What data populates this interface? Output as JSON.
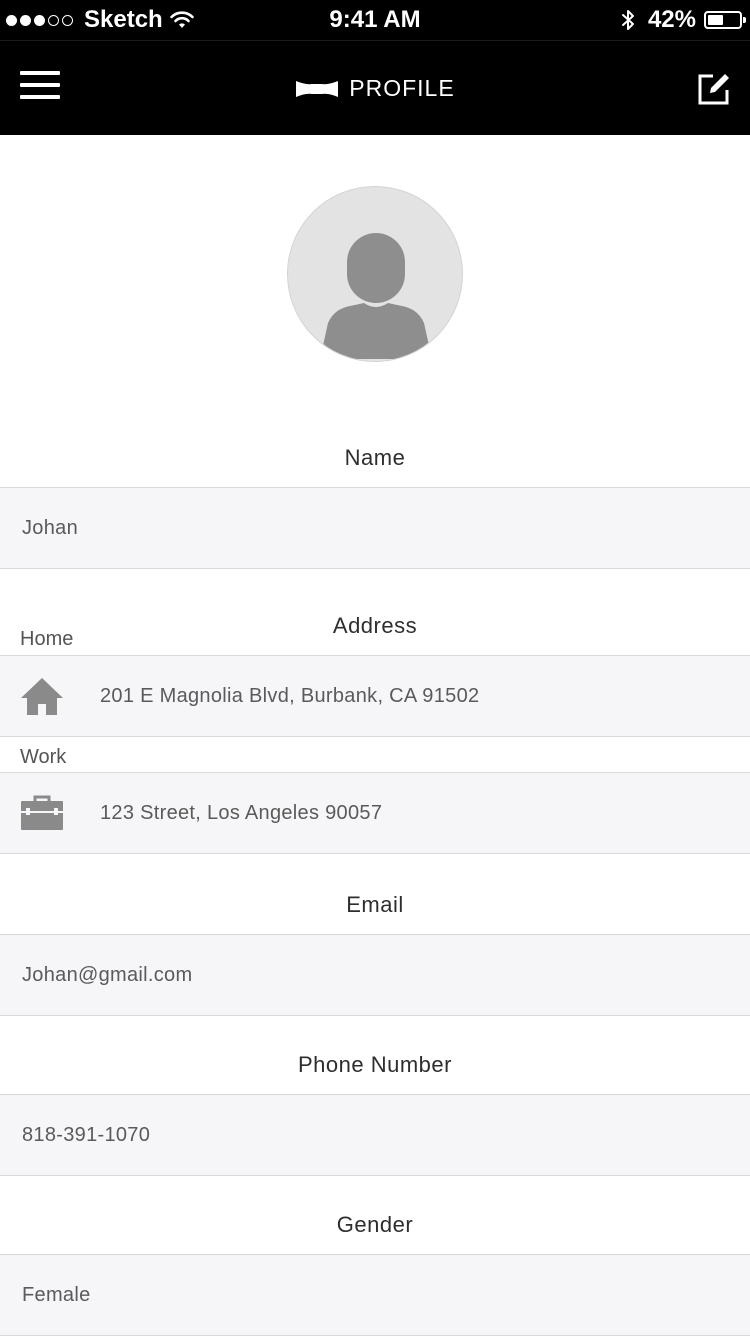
{
  "status_bar": {
    "carrier": "Sketch",
    "time": "9:41 AM",
    "battery": "42%",
    "battery_level": 0.42,
    "signal_bars": 3,
    "signal_total": 5
  },
  "nav": {
    "title": "PROFILE",
    "menu_icon": "hamburger-menu-icon",
    "logo_icon": "bowtie-icon",
    "edit_icon": "edit-icon"
  },
  "avatar": {
    "icon": "user-placeholder-icon"
  },
  "sections": {
    "name": {
      "label": "Name",
      "value": "Johan"
    },
    "address": {
      "label": "Address",
      "home": {
        "label": "Home",
        "icon": "home-icon",
        "value": "201 E Magnolia Blvd, Burbank, CA 91502"
      },
      "work": {
        "label": "Work",
        "icon": "briefcase-icon",
        "value": "123 Street, Los Angeles 90057"
      }
    },
    "email": {
      "label": "Email",
      "value": "Johan@gmail.com"
    },
    "phone": {
      "label": "Phone Number",
      "value": "818-391-1070"
    },
    "gender": {
      "label": "Gender",
      "value": "Female"
    }
  },
  "colors": {
    "bar_background": "#000000",
    "field_background": "#f6f6f8",
    "icon_gray": "#8a8a8a",
    "text_dark": "#2e2e2e",
    "text_value": "#5a5a5a"
  }
}
